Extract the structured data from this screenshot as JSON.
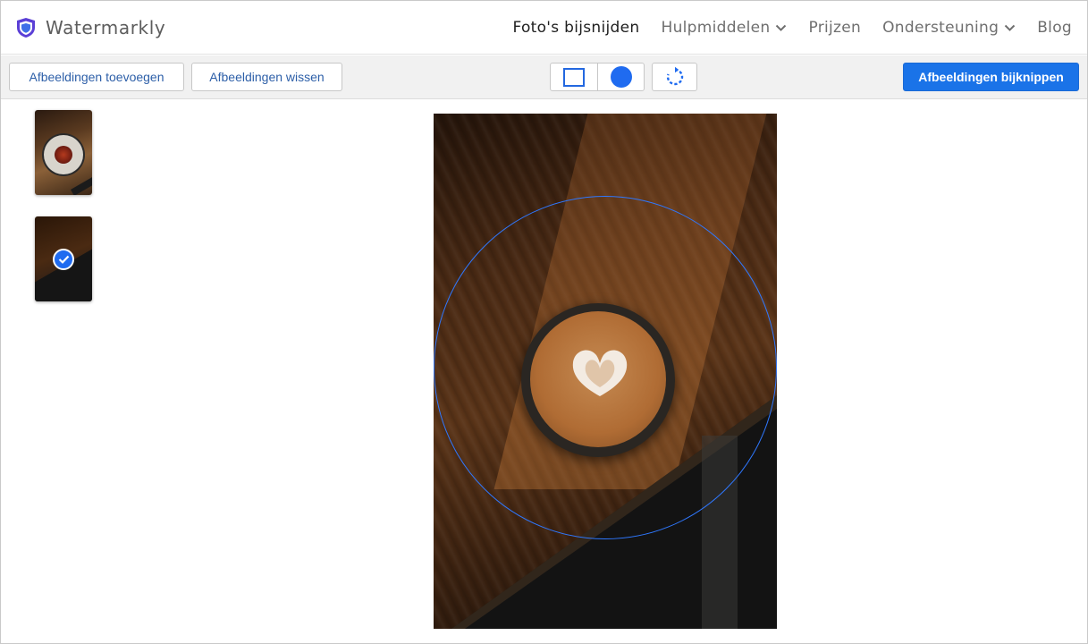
{
  "app": {
    "name": "Watermarkly",
    "logo_icon": "shield-icon"
  },
  "nav": {
    "items": [
      {
        "label": "Foto's bijsnijden",
        "active": true,
        "dropdown": false
      },
      {
        "label": "Hulpmiddelen",
        "active": false,
        "dropdown": true
      },
      {
        "label": "Prijzen",
        "active": false,
        "dropdown": false
      },
      {
        "label": "Ondersteuning",
        "active": false,
        "dropdown": true
      },
      {
        "label": "Blog",
        "active": false,
        "dropdown": false
      }
    ]
  },
  "toolbar": {
    "add_label": "Afbeeldingen toevoegen",
    "clear_label": "Afbeeldingen wissen",
    "shape_rect_icon": "rectangle-icon",
    "shape_circle_icon": "circle-icon",
    "rotate_icon": "rotate-icon",
    "crop_label": "Afbeeldingen bijknippen"
  },
  "thumbnails": [
    {
      "subject": "plate with dessert on wooden table",
      "selected": false
    },
    {
      "subject": "latte cup on wooden table",
      "selected": true
    }
  ],
  "editor": {
    "crop_shape": "circle"
  },
  "colors": {
    "accent": "#1a73e8",
    "crop_outline": "#2f78ff"
  }
}
